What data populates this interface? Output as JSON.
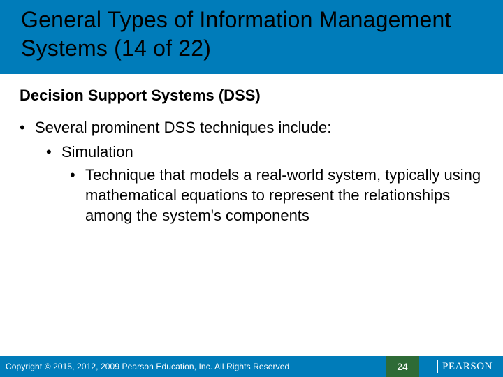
{
  "title": "General Types of Information Management Systems (14 of 22)",
  "subhead": "Decision Support Systems (DSS)",
  "body": {
    "lvl1": "Several prominent DSS techniques include:",
    "lvl2": "Simulation",
    "lvl3": "Technique that models a real-world system, typically using mathematical equations to represent the relationships among the system's components"
  },
  "footer": {
    "copyright": "Copyright © 2015, 2012, 2009 Pearson Education, Inc. All Rights Reserved",
    "page": "24",
    "logo": "PEARSON"
  }
}
